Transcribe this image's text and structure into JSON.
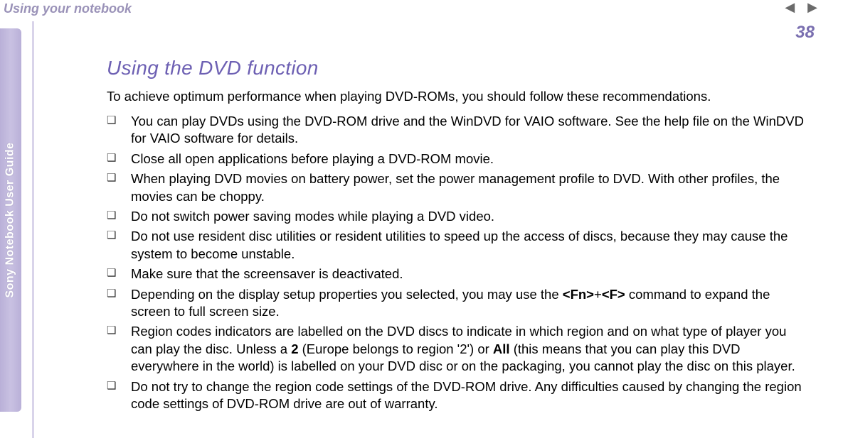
{
  "breadcrumb": "Using your notebook",
  "side_tab": "Sony Notebook User Guide",
  "page_number": "38",
  "heading": "Using the DVD function",
  "intro": "To achieve optimum performance when playing DVD-ROMs, you should follow these recommendations.",
  "bullets": {
    "b0": "You can play DVDs using the DVD-ROM drive and the WinDVD for VAIO software. See the help file on the WinDVD for VAIO software for details.",
    "b1": "Close all open applications before playing a DVD-ROM movie.",
    "b2": "When playing DVD movies on battery power, set the power management profile to DVD. With other profiles, the movies can be choppy.",
    "b3": "Do not switch power saving modes while playing a DVD video.",
    "b4": "Do not use resident disc utilities or resident utilities to speed up the access of discs, because they may cause the system to become unstable.",
    "b5": "Make sure that the screensaver is deactivated.",
    "b6_pre": "Depending on the display setup properties you selected, you may use the ",
    "b6_cmd1": "<Fn>",
    "b6_plus": "+",
    "b6_cmd2": "<F>",
    "b6_post": " command to expand the screen to full screen size.",
    "b7_pre": "Region codes indicators are labelled on the DVD discs to indicate in which region and on what type of player you can play the disc. Unless a ",
    "b7_b1": "2",
    "b7_mid1": " (Europe belongs to region '2') or ",
    "b7_b2": "All",
    "b7_post": " (this means that you can play this DVD everywhere in the world) is labelled on your DVD disc or on the packaging, you cannot play the disc on this player.",
    "b8": "Do not try to change the region code settings of the DVD-ROM drive. Any difficulties caused by changing the region code settings of DVD-ROM drive are out of warranty."
  }
}
